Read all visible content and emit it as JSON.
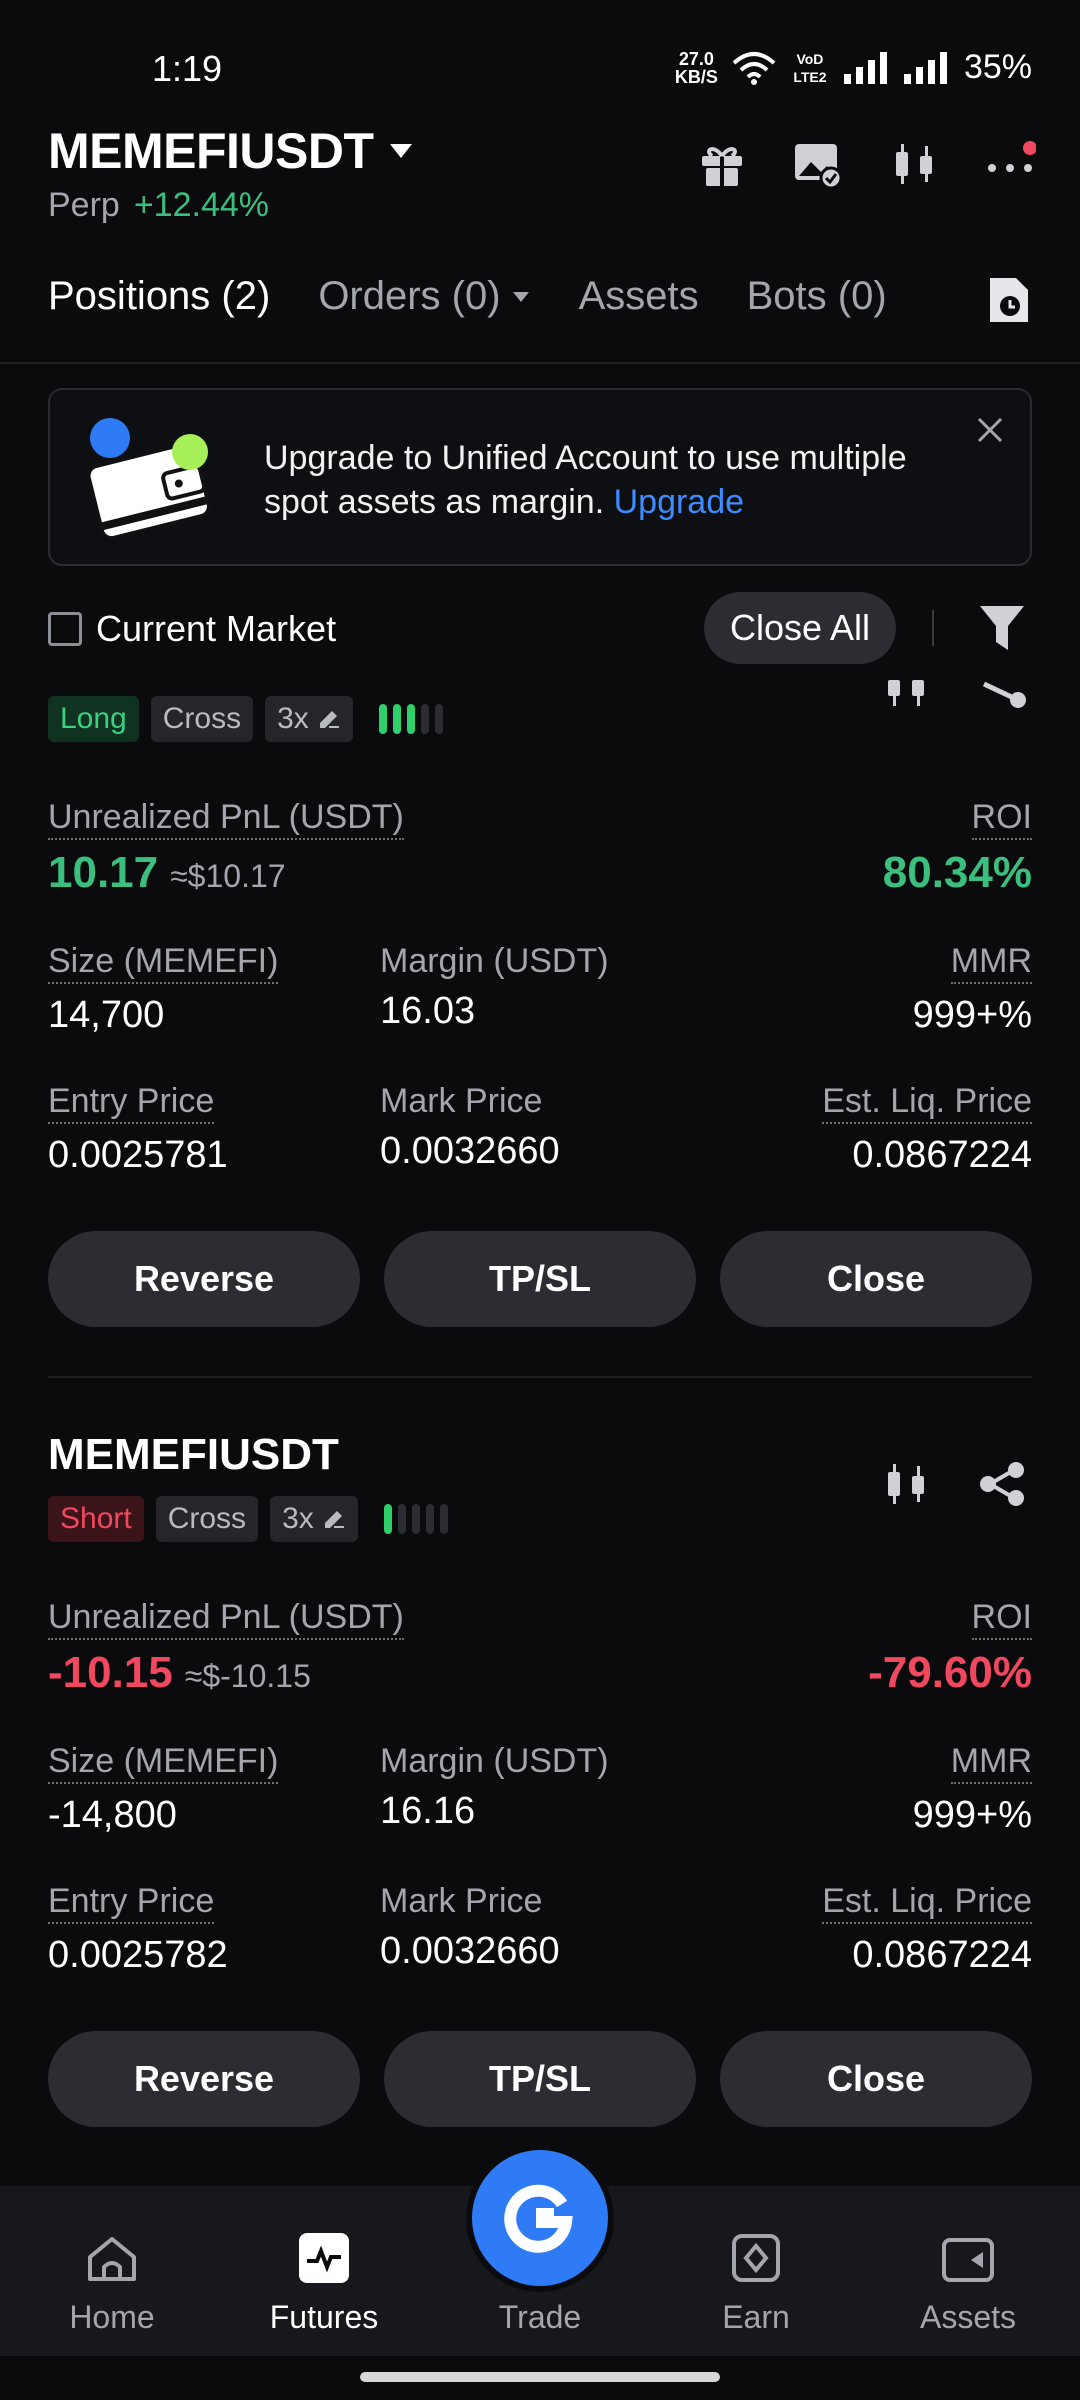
{
  "status_bar": {
    "time": "1:19",
    "net_speed": "27.0",
    "net_unit": "KB/S",
    "volte": "VoD LTE2",
    "battery": "35%"
  },
  "header": {
    "symbol": "MEMEFIUSDT",
    "type": "Perp",
    "change": "+12.44%"
  },
  "tabs": [
    {
      "label": "Positions (2)"
    },
    {
      "label": "Orders (0)"
    },
    {
      "label": "Assets"
    },
    {
      "label": "Bots (0)"
    }
  ],
  "banner": {
    "text": "Upgrade to Unified Account to use multiple spot assets as margin.",
    "link": "Upgrade"
  },
  "filters": {
    "current_market": "Current Market",
    "close_all": "Close All"
  },
  "positions": [
    {
      "symbol": "MEMEFIUSDT",
      "side": "Long",
      "margin_mode": "Cross",
      "leverage": "3x",
      "risk_level": 3,
      "pnl_label": "Unrealized PnL (USDT)",
      "pnl": "10.17",
      "pnl_approx": "≈$10.17",
      "roi_label": "ROI",
      "roi": "80.34%",
      "size_label": "Size (MEMEFI)",
      "size": "14,700",
      "margin_label": "Margin (USDT)",
      "margin": "16.03",
      "mmr_label": "MMR",
      "mmr": "999+%",
      "entry_label": "Entry Price",
      "entry": "0.0025781",
      "mark_label": "Mark Price",
      "mark": "0.0032660",
      "liq_label": "Est. Liq. Price",
      "liq": "0.0867224"
    },
    {
      "symbol": "MEMEFIUSDT",
      "side": "Short",
      "margin_mode": "Cross",
      "leverage": "3x",
      "risk_level": 1,
      "pnl_label": "Unrealized PnL (USDT)",
      "pnl": "-10.15",
      "pnl_approx": "≈$-10.15",
      "roi_label": "ROI",
      "roi": "-79.60%",
      "size_label": "Size (MEMEFI)",
      "size": "-14,800",
      "margin_label": "Margin (USDT)",
      "margin": "16.16",
      "mmr_label": "MMR",
      "mmr": "999+%",
      "entry_label": "Entry Price",
      "entry": "0.0025782",
      "mark_label": "Mark Price",
      "mark": "0.0032660",
      "liq_label": "Est. Liq. Price",
      "liq": "0.0867224"
    }
  ],
  "actions": {
    "reverse": "Reverse",
    "tpsl": "TP/SL",
    "close": "Close"
  },
  "bottom_nav": [
    {
      "label": "Home"
    },
    {
      "label": "Futures"
    },
    {
      "label": "Trade"
    },
    {
      "label": "Earn"
    },
    {
      "label": "Assets"
    }
  ],
  "colors": {
    "profit": "#3bbf7e",
    "loss": "#f0485e",
    "liq": "#f3a46e",
    "accent": "#2f7bf5",
    "link": "#3d8bff"
  }
}
